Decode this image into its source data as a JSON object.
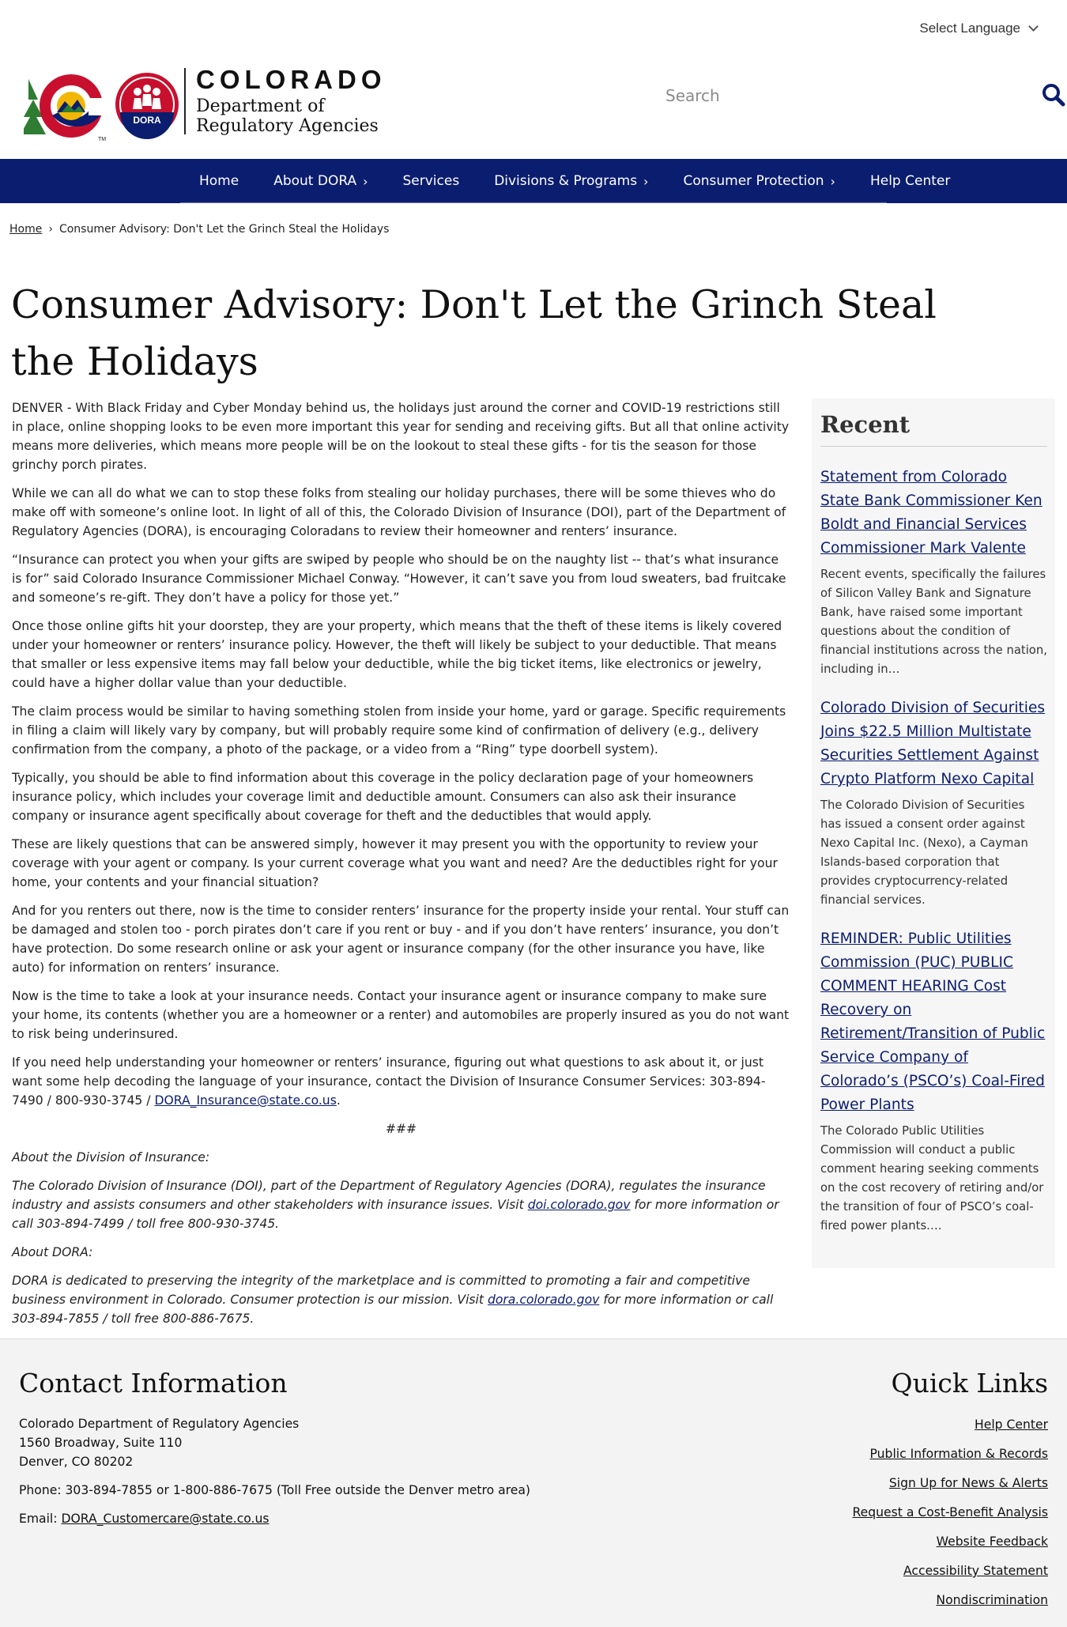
{
  "language_selector": {
    "label": "Select Language"
  },
  "header": {
    "logo_wordmark": "COLORADO",
    "logo_subtitle_line1": "Department of",
    "logo_subtitle_line2": "Regulatory Agencies",
    "logo_badge": "DORA",
    "search_placeholder": "Search"
  },
  "nav": {
    "items": [
      {
        "label": "Home",
        "has_submenu": false
      },
      {
        "label": "About DORA",
        "has_submenu": true
      },
      {
        "label": "Services",
        "has_submenu": false
      },
      {
        "label": "Divisions & Programs",
        "has_submenu": true
      },
      {
        "label": "Consumer Protection",
        "has_submenu": true
      },
      {
        "label": "Help Center",
        "has_submenu": false
      }
    ]
  },
  "breadcrumb": {
    "home": "Home",
    "separator": "›",
    "current": "Consumer Advisory: Don't Let the Grinch Steal the Holidays"
  },
  "page_title": "Consumer Advisory: Don't Let the Grinch Steal the Holidays",
  "article": {
    "paragraphs": [
      "DENVER - With Black Friday and Cyber Monday behind us, the holidays just around the corner and COVID-19 restrictions still in place, online shopping looks to be even more important this year for sending and receiving gifts. But all that online activity means more deliveries, which means more people will be on the lookout to steal these gifts - for tis the season for those grinchy porch pirates.",
      "While we can all do what we can to stop these folks from stealing our holiday purchases, there will be some thieves who do make off with someone’s online loot. In light of all of this, the Colorado Division of Insurance (DOI), part of the Department of Regulatory Agencies (DORA), is encouraging Coloradans to review their homeowner and renters’ insurance.",
      "“Insurance can protect you when your gifts are swiped by people who should be on the naughty list -- that’s what insurance is for” said Colorado Insurance Commissioner Michael Conway. “However, it can’t save you from loud sweaters, bad fruitcake and someone’s re-gift. They don’t have a policy for those yet.”",
      "Once those online gifts hit your doorstep, they are your property, which means that the theft of these items is likely covered under your homeowner or renters’ insurance policy. However, the theft will likely be subject to your deductible. That means that smaller or less expensive items may fall below your deductible, while the big ticket items, like electronics or jewelry, could have a higher dollar value than your deductible.",
      "The claim process would be similar to having something stolen from inside your home, yard or garage. Specific requirements in filing a claim will likely vary by company, but will probably require some kind of confirmation of delivery (e.g., delivery confirmation from the company, a photo of the package, or a video from a “Ring” type doorbell system).",
      "Typically, you should be able to find information about this coverage in the policy declaration page of your homeowners insurance policy, which includes your coverage limit and deductible amount. Consumers can also ask their insurance company or insurance agent specifically about coverage for theft and the deductibles that would apply.",
      "These are likely questions that can be answered simply, however it may present you with the opportunity to review your coverage with your agent or company. Is your current coverage what you want and need? Are the deductibles right for your home, your contents and your financial situation?",
      "And for you renters out there, now is the time to consider renters’ insurance for the property inside your rental. Your stuff can be damaged and stolen too - porch pirates don’t care if you rent or buy - and if you don’t have renters’ insurance, you don’t have protection. Do some research online or ask your agent or insurance company (for the other insurance you have, like auto) for information on renters’ insurance.",
      "Now is the time to take a look at your insurance needs. Contact your insurance agent or insurance company to make sure your home, its contents (whether you are a homeowner or a renter) and automobiles are properly insured as you do not want to risk being underinsured."
    ],
    "help_text": "If you need help understanding your homeowner or renters’ insurance, figuring out what questions to ask about it, or just want some help decoding the language of your insurance, contact the Division of Insurance Consumer Services: 303-894-7490 / 800-930-3745 /",
    "help_email": "DORA_Insurance@state.co.us",
    "help_end": ".",
    "separator": "###",
    "about_doi_heading": "About the Division of Insurance:",
    "about_doi_text": "The Colorado Division of Insurance (DOI), part of the Department of Regulatory Agencies (DORA), regulates the insurance industry and assists consumers and other stakeholders with insurance issues. Visit",
    "about_doi_link": "doi.colorado.gov",
    "about_doi_end": "for more information or call 303-894-7499 / toll free 800-930-3745.",
    "about_dora_heading": "About DORA:",
    "about_dora_text": "DORA is dedicated to preserving the integrity of the marketplace and is committed to promoting a fair and competitive business environment in Colorado. Consumer protection is our mission. Visit",
    "about_dora_link": "dora.colorado.gov",
    "about_dora_end": "for more information or call 303-894-7855 / toll free 800-886-7675."
  },
  "sidebar": {
    "title": "Recent",
    "items": [
      {
        "title": "Statement from Colorado State Bank Commissioner Ken Boldt and Financial Services Commissioner Mark Valente",
        "summary": "Recent events, specifically the failures of Silicon Valley Bank and Signature Bank, have raised some important questions about the condition of financial institutions across the nation, including in…"
      },
      {
        "title": "Colorado Division of Securities Joins $22.5 Million Multistate Securities Settlement Against Crypto Platform Nexo Capital",
        "summary": "The Colorado Division of Securities has issued a consent order against Nexo Capital Inc. (Nexo), a Cayman Islands-based corporation that provides cryptocurrency-related financial services."
      },
      {
        "title": "REMINDER: Public Utilities Commission (PUC) PUBLIC COMMENT HEARING Cost Recovery on Retirement/Transition of Public Service Company of Colorado’s (PSCO’s) Coal-Fired Power Plants",
        "summary": "The Colorado Public Utilities Commission will conduct a public comment hearing seeking comments on the cost recovery of retiring and/or the transition of four of PSCO’s coal-fired power plants.…"
      }
    ]
  },
  "footer": {
    "contact_title": "Contact Information",
    "address_line1": "Colorado Department of Regulatory Agencies",
    "address_line2": "1560 Broadway, Suite 110",
    "address_line3": "Denver, CO 80202",
    "phone": "Phone: 303-894-7855 or 1-800-886-7675 (Toll Free outside the Denver metro area)",
    "email_label": "Email:",
    "email": "DORA_Customercare@state.co.us",
    "quick_title": "Quick Links",
    "quick_links": [
      "Help Center",
      "Public Information & Records",
      "Sign Up for News & Alerts",
      "Request a Cost-Benefit Analysis",
      "Website Feedback",
      "Accessibility Statement",
      "Nondiscrimination"
    ]
  },
  "colors": {
    "navy": "#0b1d6e",
    "red": "#c8102e",
    "green": "#2e7d32",
    "gold": "#f2b705"
  }
}
